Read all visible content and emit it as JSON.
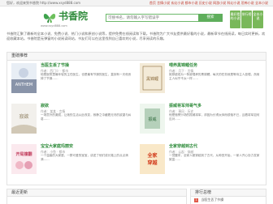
{
  "topbar": {
    "left": "您好，欢迎来到书香院 http://www.xsyd888.com",
    "right": "首页 言情小说 玄幻小说 都市小说 历史小说 网游小说 科幻小说 恐怖小说 全本小说"
  },
  "logo": {
    "name": "书香院",
    "sub": "www.xsyd888.com"
  },
  "search": {
    "placeholder": "可搜书名，请勿输入字写错误字",
    "button": "搜索"
  },
  "quick_links": [
    "最好看的小说",
    "排行榜",
    "全本小说"
  ],
  "intro": "书香院汇聚了最新的全本小说、免费小说、热门小说和原创小说等，提供免费在线阅读和下载。书香院为广大书友提供最好看的小说，最新章节在线阅读，每日实时更新，欢迎收藏本站。书香院是无弹窗的小说阅读网站，书友们可以在这里找到自己喜欢的小说，尽享阅读的乐趣。",
  "section": {
    "title": "重磅推荐"
  },
  "books": [
    {
      "title": "当医生丢了节操",
      "meta": "作者：西门少 · 都市",
      "desc": "他是医院里最年轻的主任医生，也是最有节操的医生，直到有一天他丢掉了节操……"
    },
    {
      "title": "喂养黑锦鲤任务",
      "meta": "作者：月下 · 言情",
      "desc": "她穿越成为一条被喂养的黑锦鲤，每天的任务就是等待主人投喂，然而主人似乎不太一样……"
    },
    {
      "title": "寂欲",
      "meta": "作者：某某 · 言情",
      "desc": "一场意外的邂逅，让她的生活从此改变，寂静之中藏着无尽的欲望与纠葛……"
    },
    {
      "title": "振威将军帅哥气多",
      "meta": "作者：萧风 · 历史",
      "desc": "他是驰骋沙场的振威将军，却因为长得太帅而烦恼不已，且看将军如何应对……"
    },
    {
      "title": "宝宝大家庭玛丽安",
      "meta": "作者：小鱼 · 都市",
      "desc": "一个温馨的大家庭，一群可爱的宝宝，讲述了他们成长路上的点点滴滴……"
    },
    {
      "title": "全家穿越到古代",
      "meta": "作者：云起 · 穿越",
      "desc": "一觉醒来，全家人都穿越到了古代，从种田开始，一家人齐心协力发家致富……"
    }
  ],
  "covers": [
    {
      "bg": "#e8eef5",
      "accent": "#3a4a6a",
      "text": "ANTHEM"
    },
    {
      "bg": "#f3ead7",
      "accent": "#8a6a3a",
      "text": "黑锦鲤"
    },
    {
      "bg": "#f2f0ec",
      "accent": "#b0a080",
      "text": "寂欲"
    },
    {
      "bg": "#eef6ee",
      "accent": "#4a8a5a",
      "text": "振威"
    },
    {
      "bg": "#fbe9ee",
      "accent": "#c03a5a",
      "text": "开局撞翻"
    },
    {
      "bg": "#f9e8c8",
      "accent": "#d23a1a",
      "text": "全家穿越"
    }
  ],
  "side": {
    "title": "最近更新"
  },
  "rank": {
    "title": "排行总榜",
    "first_num": "1",
    "first_title": "当医生丢了节操"
  }
}
